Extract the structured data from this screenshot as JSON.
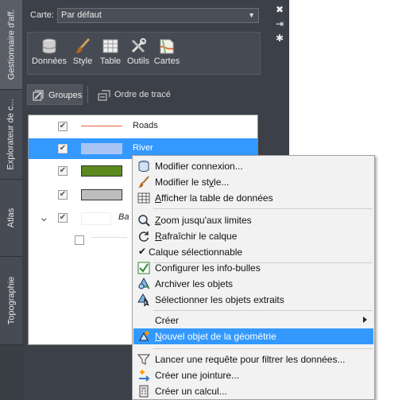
{
  "tabs": [
    {
      "label": "Gestionnaire d'aff.",
      "active": true
    },
    {
      "label": "Explorateur de c...",
      "active": false
    },
    {
      "label": "Atlas",
      "active": false
    },
    {
      "label": "Topographie",
      "active": false
    }
  ],
  "map": {
    "label": "Carte:",
    "value": "Par défaut"
  },
  "toolbar": {
    "donnees": "Données",
    "style": "Style",
    "table": "Table",
    "outils": "Outils",
    "cartes": "Cartes"
  },
  "subbar": {
    "groupes": "Groupes",
    "ordre": "Ordre de tracé"
  },
  "layers": [
    {
      "name": "Roads",
      "checked": true
    },
    {
      "name": "River",
      "checked": true,
      "selected": true
    },
    {
      "name": "",
      "checked": true
    },
    {
      "name": "",
      "checked": true
    },
    {
      "name": "Ba",
      "checked": true
    },
    {
      "name": "",
      "checked": false
    }
  ],
  "context_menu": {
    "modifier_connexion": "Modifier connexion...",
    "modifier_style_pre": "Modifier le st",
    "modifier_style_u": "y",
    "modifier_style_post": "le...",
    "afficher_table_u": "A",
    "afficher_table_post": "fficher la table de données",
    "zoom_u": "Z",
    "zoom_post": "oom jusqu'aux limites",
    "rafraichir_u": "R",
    "rafraichir_post": "afraîchir le calque",
    "calque_selectionnable": "Calque sélectionnable",
    "configurer": "Configurer les info-bulles",
    "archiver": "Archiver les objets",
    "selectionner_extraits": "Sélectionner les objets extraits",
    "creer": "Créer",
    "nouvel_u": "N",
    "nouvel_post": "ouvel objet de la géométrie",
    "lancer_requete": "Lancer une requête pour filtrer les données...",
    "creer_jointure": "Créer une jointure...",
    "creer_calcul": "Créer un calcul..."
  },
  "colors": {
    "panel_bg": "#3c4048",
    "selection": "#3399ff",
    "road_line": "#e8643c",
    "river_fill": "#a8c4f4",
    "green_fill": "#5a8a1e",
    "gray_fill": "#bdbdbd"
  }
}
